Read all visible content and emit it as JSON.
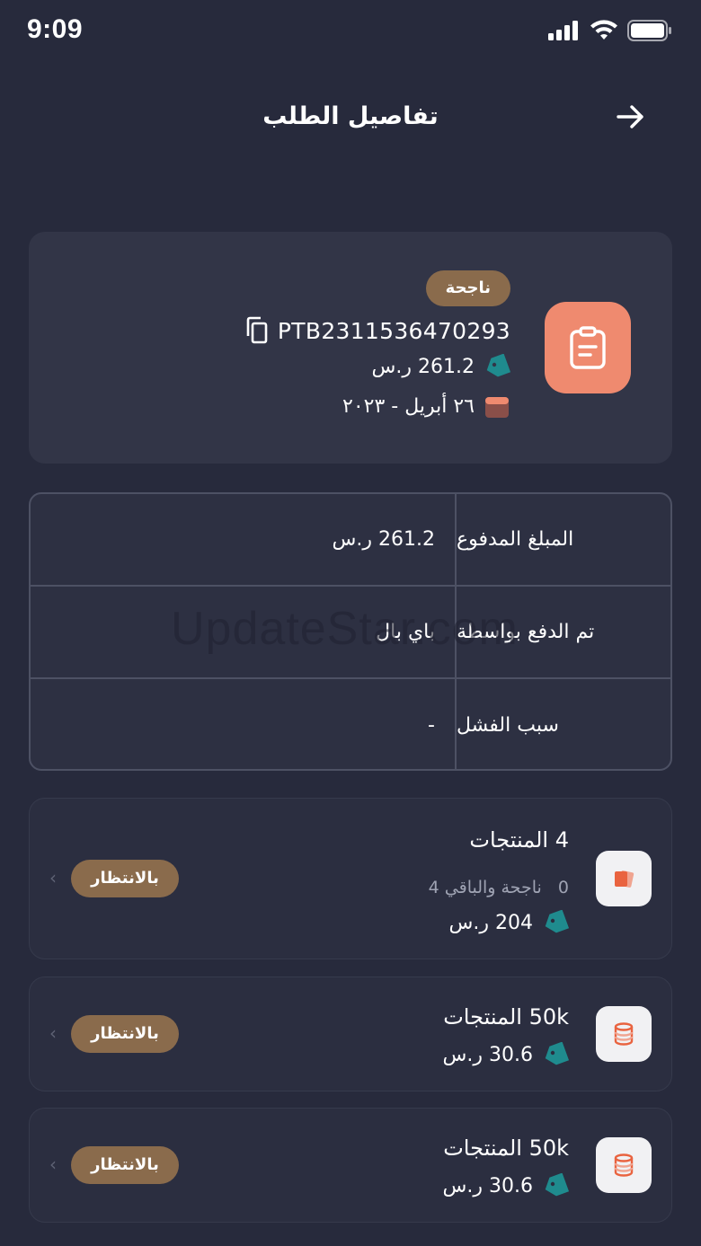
{
  "status_bar": {
    "time": "9:09"
  },
  "header": {
    "title": "تفاصيل الطلب"
  },
  "summary": {
    "status": "ناجحة",
    "order_id": "PTB2311536470293",
    "amount": "261.2 ر.س",
    "date": "٢٦ أبريل - ٢٠٢٣",
    "accent": "#ef8a6f"
  },
  "info_table": [
    {
      "label": "المبلغ المدفوع",
      "value": "261.2 ر.س"
    },
    {
      "label": "تم الدفع بواسطة",
      "value": "باي بال"
    },
    {
      "label": "سبب الفشل",
      "value": "-"
    }
  ],
  "watermark": "UpdateStar.com",
  "products": [
    {
      "title": "4 المنتجات",
      "sub_count": "0",
      "sub_text": "ناجحة والباقي 4",
      "price": "204 ر.س",
      "status": "بالانتظار",
      "icon": "cards-icon"
    },
    {
      "title": "50k المنتجات",
      "price": "30.6 ر.س",
      "status": "بالانتظار",
      "icon": "coins-icon"
    },
    {
      "title": "50k المنتجات",
      "price": "30.6 ر.س",
      "status": "بالانتظار",
      "icon": "coins-icon"
    }
  ]
}
